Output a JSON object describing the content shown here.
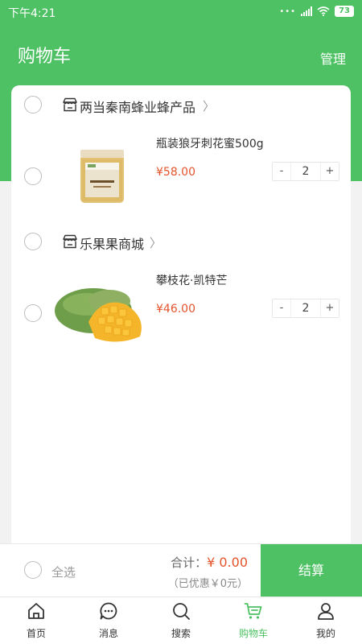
{
  "status_bar": {
    "time": "下午4:21",
    "battery": "73"
  },
  "header": {
    "title": "购物车",
    "manage": "管理"
  },
  "shops": [
    {
      "name": "两当秦南蜂业蜂产品",
      "items": [
        {
          "title": "瓶装狼牙刺花蜜500g",
          "price": "¥58.00",
          "qty": "2",
          "minus": "-",
          "plus": "+",
          "image": "honey-jar"
        }
      ]
    },
    {
      "name": "乐果果商城",
      "items": [
        {
          "title": "攀枝花·凯特芒",
          "price": "¥46.00",
          "qty": "2",
          "minus": "-",
          "plus": "+",
          "image": "mango"
        }
      ]
    }
  ],
  "bottom": {
    "select_all": "全选",
    "total_label": "合计：",
    "total_amount": "¥ 0.00",
    "discount": "（已优惠￥0元）",
    "checkout": "结算"
  },
  "tabs": [
    {
      "label": "首页",
      "icon": "home-icon"
    },
    {
      "label": "消息",
      "icon": "message-icon"
    },
    {
      "label": "搜索",
      "icon": "search-icon"
    },
    {
      "label": "购物车",
      "icon": "cart-icon",
      "active": true
    },
    {
      "label": "我的",
      "icon": "user-icon"
    }
  ],
  "colors": {
    "accent": "#4dc163",
    "price": "#e4532c"
  }
}
